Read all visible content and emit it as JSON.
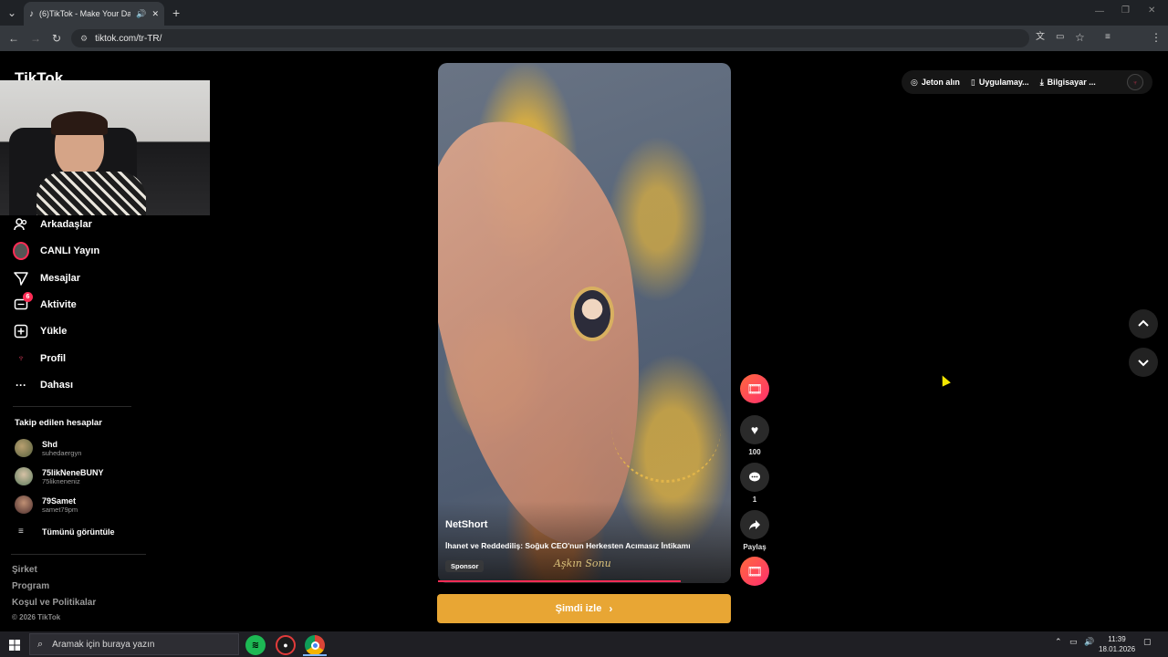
{
  "browser": {
    "tab_title": "(6)TikTok - Make Your Day",
    "url": "tiktok.com/tr-TR/"
  },
  "logo_text": "TikTok",
  "sidebar": {
    "nav": [
      {
        "label": "Arkadaşlar",
        "icon": "friends-icon"
      },
      {
        "label": "CANLI Yayın",
        "icon": "live-icon"
      },
      {
        "label": "Mesajlar",
        "icon": "messages-icon"
      },
      {
        "label": "Aktivite",
        "icon": "activity-icon",
        "badge": "6"
      },
      {
        "label": "Yükle",
        "icon": "upload-icon"
      },
      {
        "label": "Profil",
        "icon": "profile-icon"
      },
      {
        "label": "Dahası",
        "icon": "more-icon"
      }
    ],
    "following_title": "Takip edilen hesaplar",
    "following": [
      {
        "name": "Shd",
        "username": "suhedaergyn"
      },
      {
        "name": "75likNeneBUNY",
        "username": "75likneneniz"
      },
      {
        "name": "79Samet",
        "username": "samet79pm"
      }
    ],
    "see_all": "Tümünü görüntüle",
    "footer": {
      "company": "Şirket",
      "program": "Program",
      "terms": "Koşul ve Politikalar",
      "copyright": "© 2026 TikTok"
    }
  },
  "top_actions": {
    "coins": "Jeton alın",
    "app": "Uygulamay...",
    "desktop": "Bilgisayar ..."
  },
  "video": {
    "author": "NetShort",
    "description": "İhanet ve Reddediliş: Soğuk CEO'nun Herkesten Acımasız İntikamı",
    "sponsor_label": "Sponsor",
    "watermark": "Aşkın Sonu",
    "progress": 0.83,
    "cta": "Şimdi izle"
  },
  "actions": {
    "likes": "100",
    "comments": "1",
    "share": "Paylaş"
  },
  "taskbar": {
    "search_placeholder": "Aramak için buraya yazın",
    "time": "11:39",
    "date": "18.01.2026"
  }
}
